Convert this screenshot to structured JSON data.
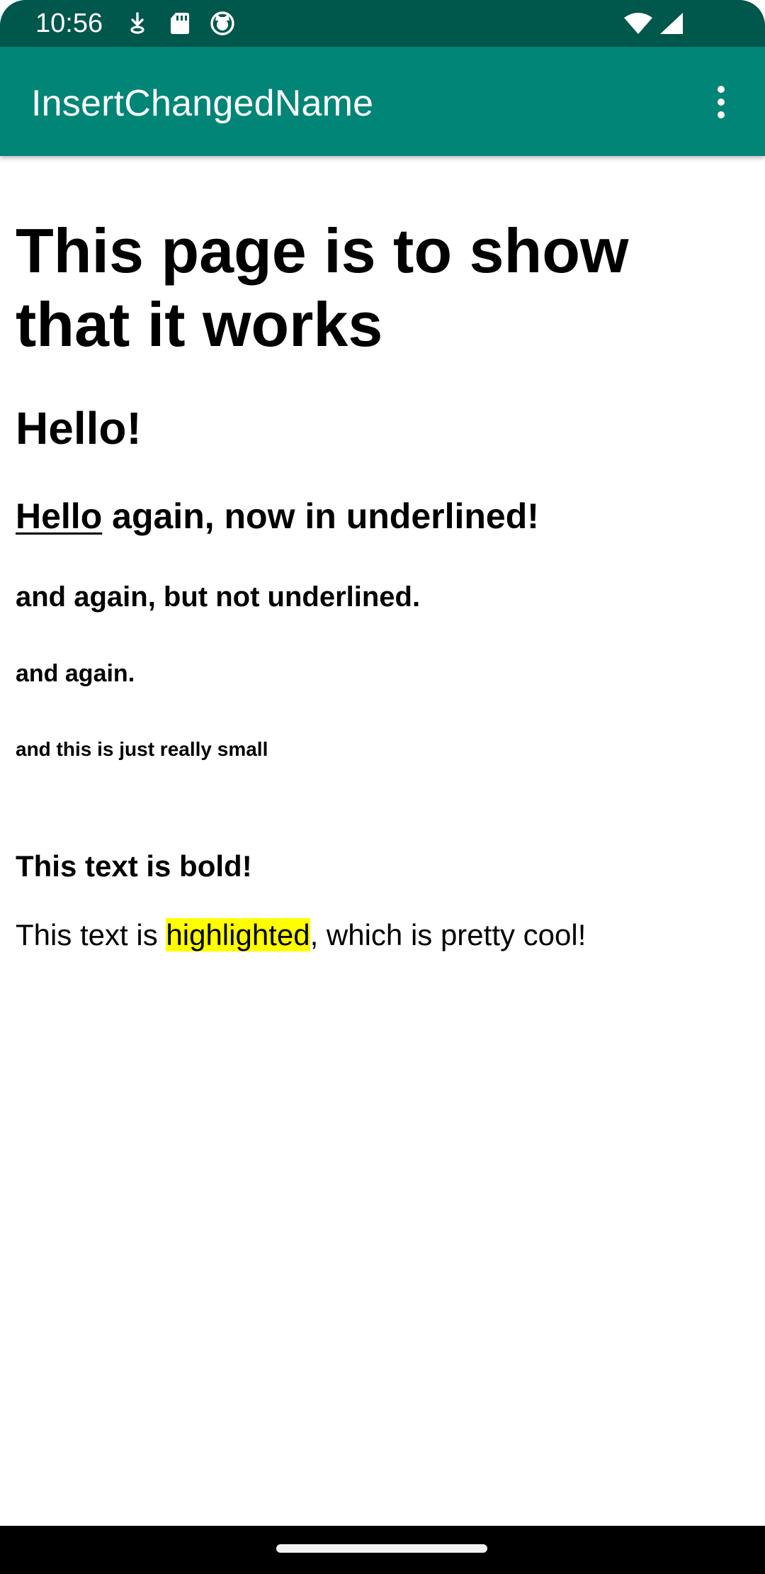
{
  "status_bar": {
    "time": "10:56",
    "icons": [
      "download-arrow-icon",
      "sd-card-icon",
      "cat-face-icon",
      "wifi-icon",
      "cellular-signal-icon"
    ]
  },
  "app_bar": {
    "title": "InsertChangedName",
    "menu_icon": "more-vert-icon",
    "background": "#008577",
    "status_background": "#00574b"
  },
  "content": {
    "heading1": "This page is to show that it works",
    "heading2": "Hello!",
    "heading3_underlined": "Hello",
    "heading3_rest": " again, now in underlined!",
    "heading4": "and again, but not underlined.",
    "heading5": "and again.",
    "heading6": "and this is just really small",
    "bold_text": "This text is bold!",
    "para_before": "This text is ",
    "para_highlight": "highlighted",
    "para_after": ", which is pretty cool!",
    "highlight_color": "#ffff00"
  },
  "nav_bar": {
    "handle": "home-gesture-handle"
  }
}
